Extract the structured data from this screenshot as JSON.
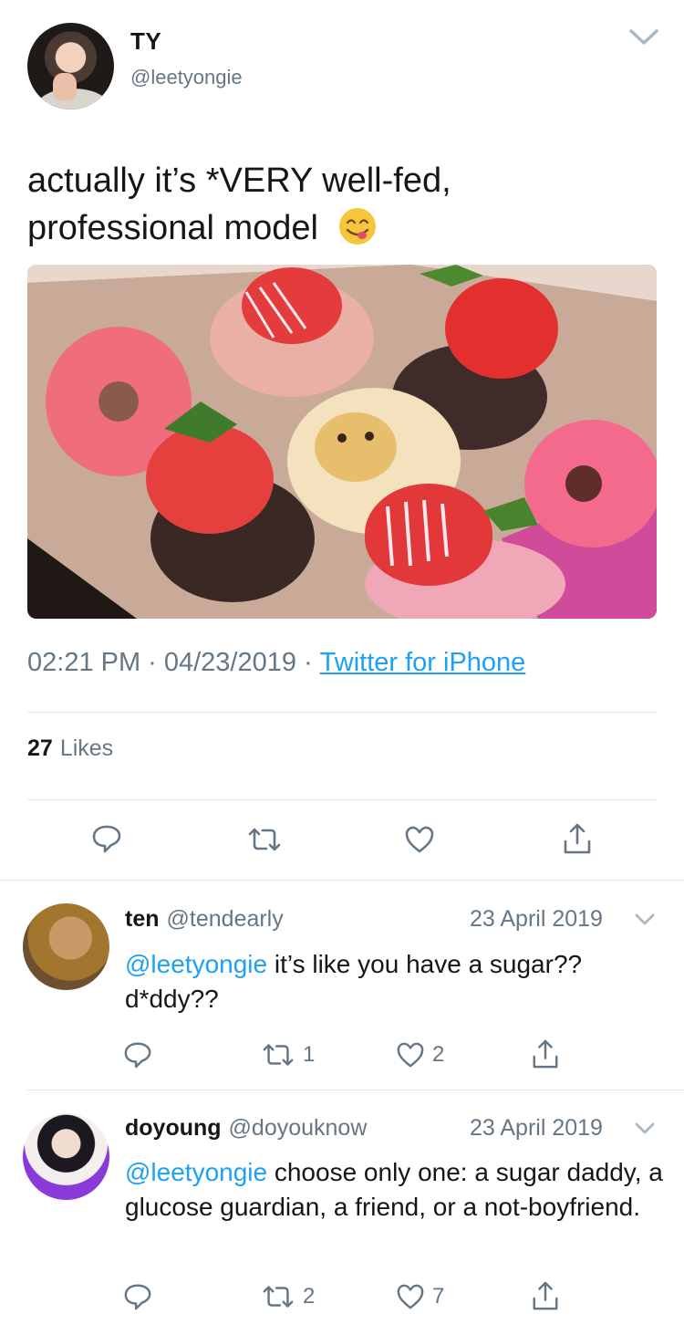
{
  "tweet": {
    "display_name": "TY",
    "handle": "@leetyongie",
    "text": "actually it’s *VERY well-fed, professional model",
    "emoji": "face-savoring-food-emoji",
    "photo": "box-of-donuts-photo",
    "time": "02:21 PM",
    "date": "04/23/2019",
    "source": "Twitter for iPhone",
    "likes_count": "27",
    "likes_label": "Likes"
  },
  "replies": [
    {
      "display_name": "ten",
      "handle": "@tendearly",
      "date": "23 April 2019",
      "mention": "@leetyongie",
      "text": " it’s like you have a sugar?? d*ddy??",
      "retweets": "1",
      "likes": "2"
    },
    {
      "display_name": "doyoung",
      "handle": "@doyouknow",
      "date": "23 April 2019",
      "mention": "@leetyongie",
      "text": " choose only one: a sugar daddy, a glucose guardian, a friend, or a not-boyfriend.",
      "retweets": "2",
      "likes": "7"
    }
  ],
  "colors": {
    "accent": "#1da1f2",
    "muted": "#657786",
    "text": "#14171a",
    "divider": "#e1e8ed"
  }
}
